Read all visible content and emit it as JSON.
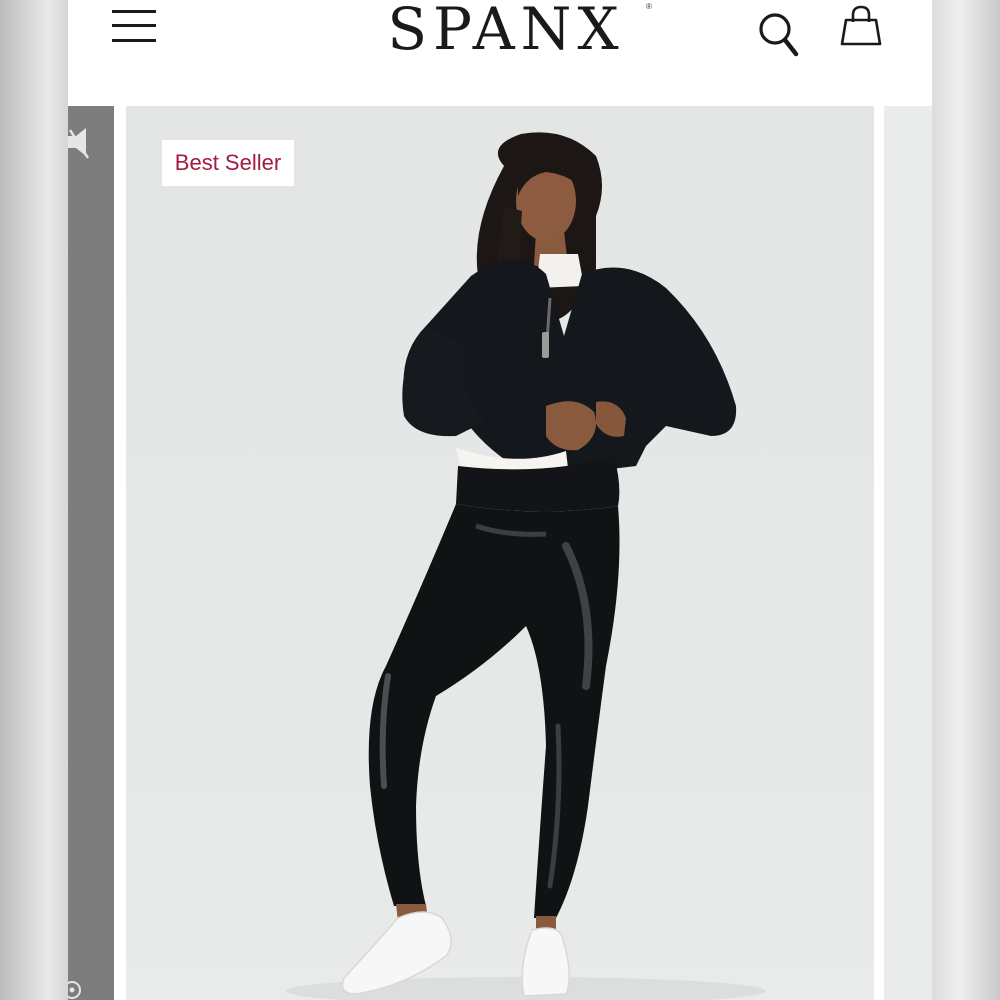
{
  "header": {
    "logo_text": "SPANX",
    "logo_mark": "®",
    "icons": [
      "menu-icon",
      "search-icon",
      "shopping-bag-icon"
    ]
  },
  "product_image": {
    "badge_label": "Best Seller",
    "badge_color": "#a51a3f",
    "subject": "product-photo"
  },
  "side_icons": [
    "mute-icon",
    "info-icon"
  ]
}
